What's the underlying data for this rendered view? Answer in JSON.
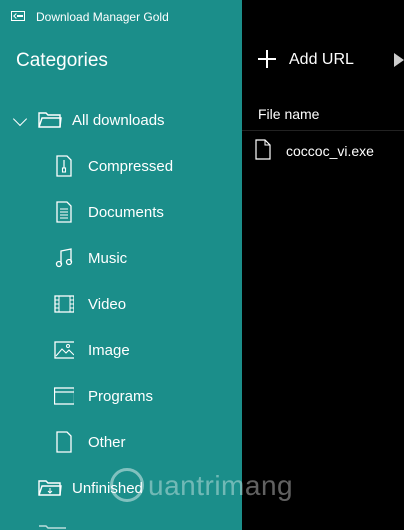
{
  "window": {
    "title": "Download Manager Gold"
  },
  "sidebar": {
    "header": "Categories",
    "root": {
      "label": "All downloads",
      "expanded": true
    },
    "categories": [
      {
        "label": "Compressed",
        "icon": "zip-icon"
      },
      {
        "label": "Documents",
        "icon": "document-icon"
      },
      {
        "label": "Music",
        "icon": "music-icon"
      },
      {
        "label": "Video",
        "icon": "video-icon"
      },
      {
        "label": "Image",
        "icon": "image-icon"
      },
      {
        "label": "Programs",
        "icon": "program-icon"
      },
      {
        "label": "Other",
        "icon": "file-icon"
      }
    ],
    "unfinished": {
      "label": "Unfinished"
    }
  },
  "toolbar": {
    "add_url_label": "Add URL"
  },
  "file_list": {
    "column_header": "File name",
    "files": [
      {
        "name": "coccoc_vi.exe"
      }
    ]
  },
  "watermark": {
    "text": "uantrimang"
  },
  "colors": {
    "sidebar_bg": "#1b8e8a",
    "main_bg": "#000000",
    "text": "#ffffff"
  }
}
